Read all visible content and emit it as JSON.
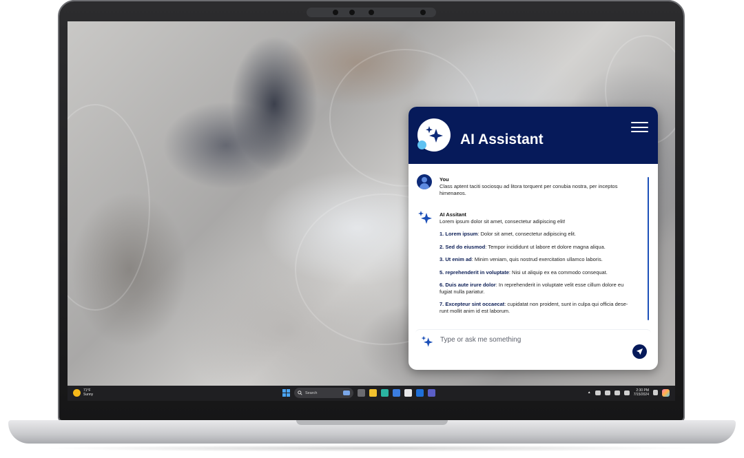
{
  "assistant": {
    "title": "AI Assistant",
    "menu_icon": "hamburger-icon",
    "logo_icon": "sparkle-icon",
    "accent_color": "#061a5a",
    "input_placeholder": "Type or ask me something",
    "send_icon": "send-icon"
  },
  "conversation": {
    "user": {
      "name": "You",
      "text": "Class aptent taciti sociosqu ad litora torquent per conubia nostra, per inceptos himenaeos."
    },
    "assistant": {
      "name": "AI Assitant",
      "intro": "Lorem ipsum dolor sit amet, consectetur adipiscing elit!",
      "items": [
        {
          "num": "1.",
          "term": "Lorem ipsum",
          "text": ": Dolor sit amet, consectetur adipiscing elit."
        },
        {
          "num": "2.",
          "term": "Sed do eiusmod",
          "text": ": Tempor incididunt ut labore et dolore magna aliqua."
        },
        {
          "num": "3.",
          "term": "Ut enim ad",
          "text": ": Minim veniam, quis nostrud exercitation ullamco laboris."
        },
        {
          "num": "5.",
          "term": "reprehenderit in voluptate",
          "text": ": Nisi ut aliquip ex ea commodo consequat."
        },
        {
          "num": "6.",
          "term": "Duis aute irure dolor",
          "text": ": In reprehenderit in voluptate velit esse cillum dolore eu fugiat nulla pariatur."
        },
        {
          "num": "7.",
          "term": "Excepteur sint occaecat",
          "text": ": cupidatat non proident, sunt in culpa qui officia dese-runt mollit anim id est laborum."
        }
      ]
    }
  },
  "taskbar": {
    "weather_temp": "71°F",
    "weather_desc": "Sunny",
    "search_label": "Search",
    "time": "2:30 PM",
    "date": "7/15/2024"
  }
}
